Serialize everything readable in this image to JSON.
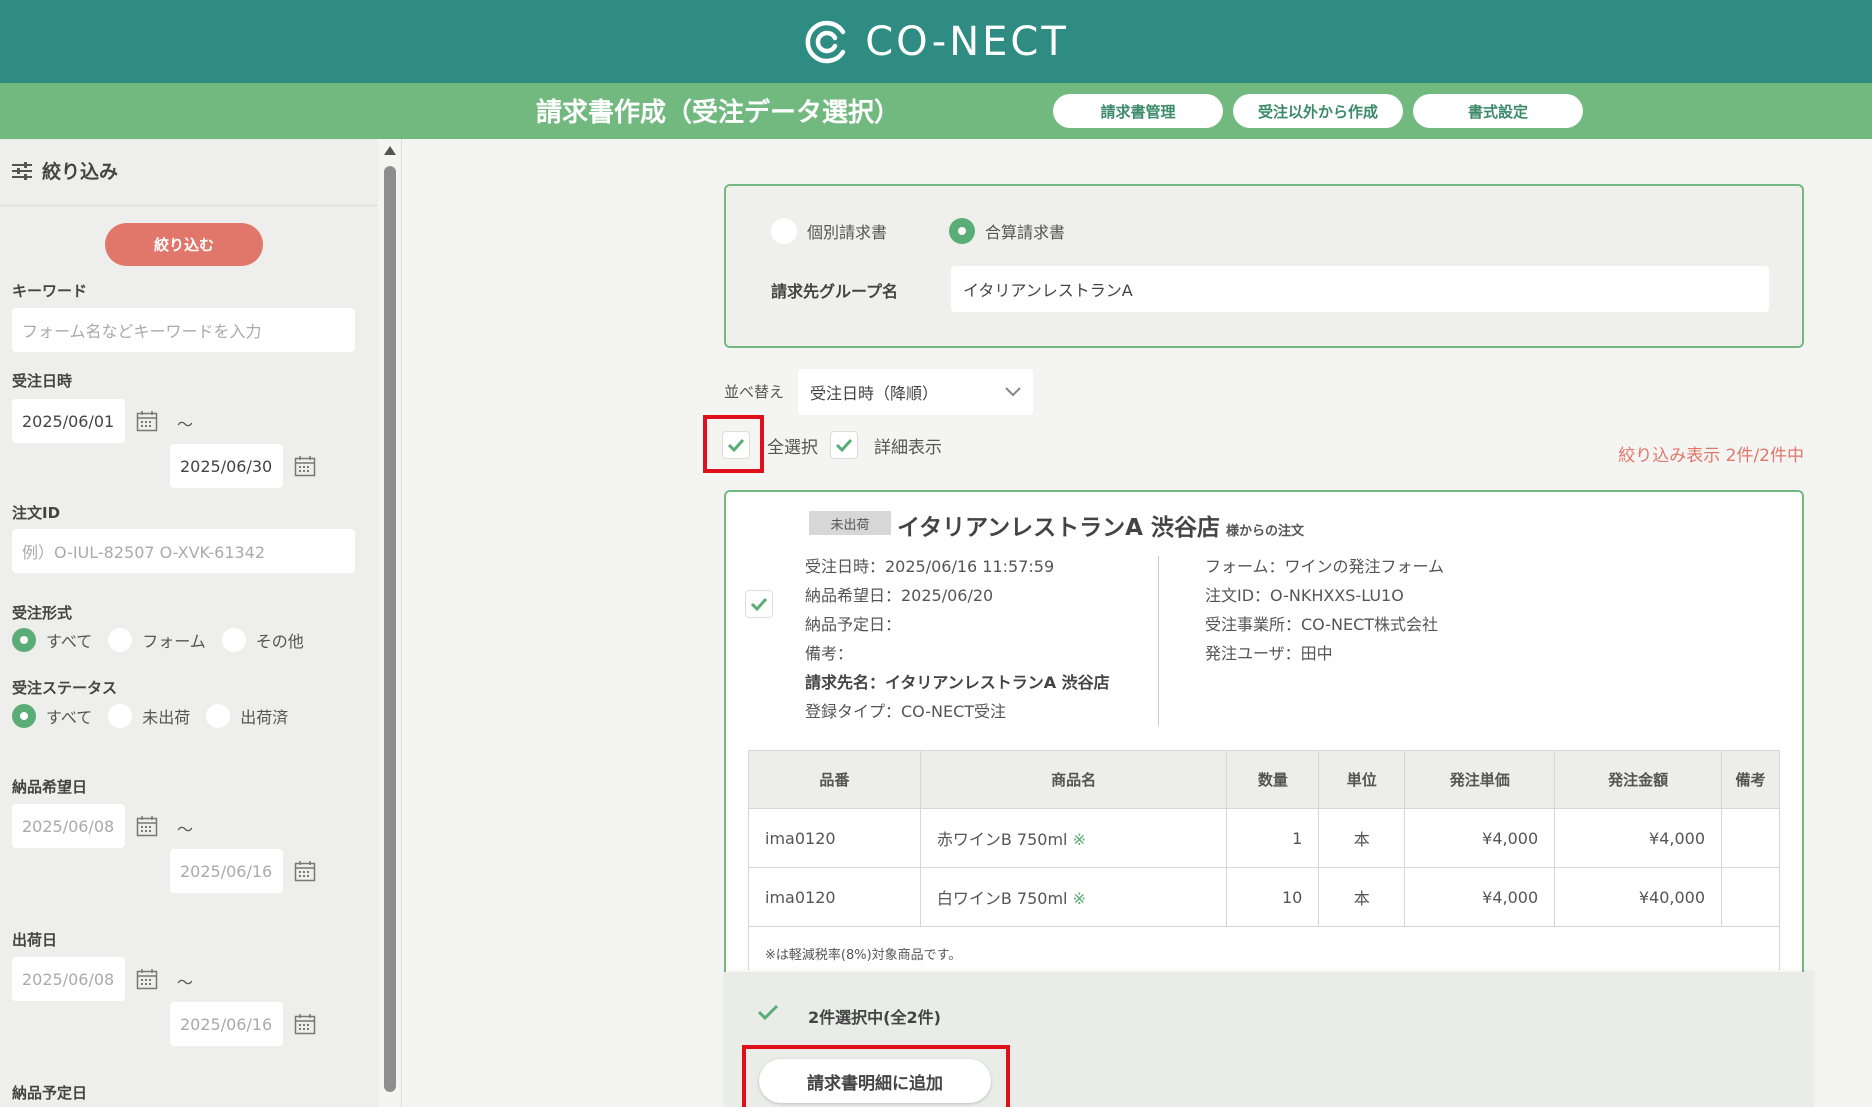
{
  "header": {
    "logo_text": "CO-NECT",
    "page_title": "請求書作成（受注データ選択）",
    "buttons": [
      "請求書管理",
      "受注以外から作成",
      "書式設定"
    ]
  },
  "sidebar": {
    "title": "絞り込み",
    "filter_button": "絞り込む",
    "keyword": {
      "label": "キーワード",
      "placeholder": "フォーム名などキーワードを入力"
    },
    "order_date": {
      "label": "受注日時",
      "from": "2025/06/01",
      "to": "2025/06/30"
    },
    "tilde": "～",
    "order_id": {
      "label": "注文ID",
      "placeholder": "例）O-IUL-82507 O-XVK-61342"
    },
    "order_type": {
      "label": "受注形式",
      "options": [
        "すべて",
        "フォーム",
        "その他"
      ],
      "selected": 0
    },
    "order_status": {
      "label": "受注ステータス",
      "options": [
        "すべて",
        "未出荷",
        "出荷済"
      ],
      "selected": 0
    },
    "desired_delivery": {
      "label": "納品希望日",
      "from": "2025/06/08",
      "to": "2025/06/16"
    },
    "ship_date": {
      "label": "出荷日",
      "from": "2025/06/08",
      "to": "2025/06/16"
    },
    "planned_delivery": {
      "label": "納品予定日"
    }
  },
  "invoice_type": {
    "options": [
      "個別請求書",
      "合算請求書"
    ],
    "selected": 1,
    "group_label": "請求先グループ名",
    "group_value": "イタリアンレストランA"
  },
  "sort": {
    "label": "並べ替え",
    "value": "受注日時（降順）"
  },
  "select_all_label": "全選択",
  "detail_label": "詳細表示",
  "count_text": "絞り込み表示 2件/2件中",
  "order": {
    "status_badge": "未出荷",
    "store": "イタリアンレストランA 渋谷店",
    "store_suffix": "様からの注文",
    "left_info": [
      "受注日時：2025/06/16 11:57:59",
      "納品希望日：2025/06/20",
      "納品予定日：",
      "備考：",
      "請求先名：イタリアンレストランA 渋谷店",
      "登録タイプ：CO-NECT受注"
    ],
    "right_info": [
      "フォーム：ワインの発注フォーム",
      "注文ID：O-NKHXXS-LU1O",
      "受注事業所：CO-NECT株式会社",
      "発注ユーザ：田中"
    ],
    "table": {
      "headers": [
        "品番",
        "商品名",
        "数量",
        "単位",
        "発注単価",
        "発注金額",
        "備考"
      ],
      "rows": [
        [
          "ima0120",
          "赤ワインB 750ml",
          "1",
          "本",
          "¥4,000",
          "¥4,000",
          ""
        ],
        [
          "ima0120",
          "白ワインB 750ml",
          "10",
          "本",
          "¥4,000",
          "¥40,000",
          ""
        ]
      ],
      "reduced_mark": "※",
      "note": "※は軽減税率(8%)対象商品です。"
    }
  },
  "bottom": {
    "selected_text": "2件選択中(全2件)",
    "add_button": "請求書明細に追加"
  },
  "colors": {
    "header": "#2e8c82",
    "subheader": "#72b980",
    "accent_red": "#e0776a",
    "highlight": "#e0101a"
  }
}
